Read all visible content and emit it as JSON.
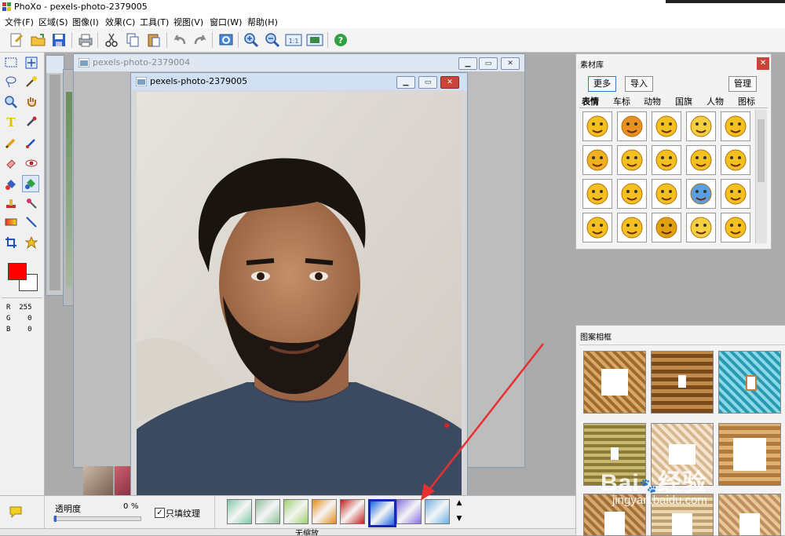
{
  "app": {
    "title": "PhoXo - pexels-photo-2379005"
  },
  "menu": [
    "文件(F)",
    "区域(S)",
    "图像(I)",
    "效果(C)",
    "工具(T)",
    "视图(V)",
    "窗口(W)",
    "帮助(H)"
  ],
  "toolbar_icons": [
    "new-icon",
    "open-icon",
    "save-icon",
    "print-icon",
    "cut-icon",
    "copy-icon",
    "paste-icon",
    "undo-icon",
    "redo-icon",
    "refresh-icon",
    "zoom-in-icon",
    "zoom-out-icon",
    "actual-size-icon",
    "fit-window-icon",
    "help-icon"
  ],
  "color": {
    "primary": "#ff0000",
    "secondary": "#ffffff",
    "r_label": "R",
    "g_label": "G",
    "b_label": "B",
    "r": "255",
    "g": "0",
    "b": "0"
  },
  "windows": {
    "back": {
      "title": "pexels-photo-2379004"
    },
    "front": {
      "title": "pexels-photo-2379005"
    }
  },
  "materials": {
    "title": "素材库",
    "more_button": "更多",
    "import_button": "导入",
    "manage_button": "管理",
    "tabs": [
      "表情",
      "车标",
      "动物",
      "国旗",
      "人物",
      "图标"
    ]
  },
  "frames": {
    "title": "图案相框"
  },
  "bottom": {
    "opacity_label": "透明度",
    "opacity_value": "0",
    "opacity_unit": "%",
    "fill_texture_label": "只填纹理",
    "fill_texture_checked": true,
    "status_text": "无缩放"
  },
  "swatches": [
    "#7fc9a9",
    "#8fbf9a",
    "#9ccf6a",
    "#e68a17",
    "#c81b1b",
    "#1b66e0",
    "#8a6ee8",
    "#6ab0e8"
  ],
  "watermark": {
    "line1": "Bai",
    "line2": "经验",
    "url": "jingyan.baidu.com"
  }
}
